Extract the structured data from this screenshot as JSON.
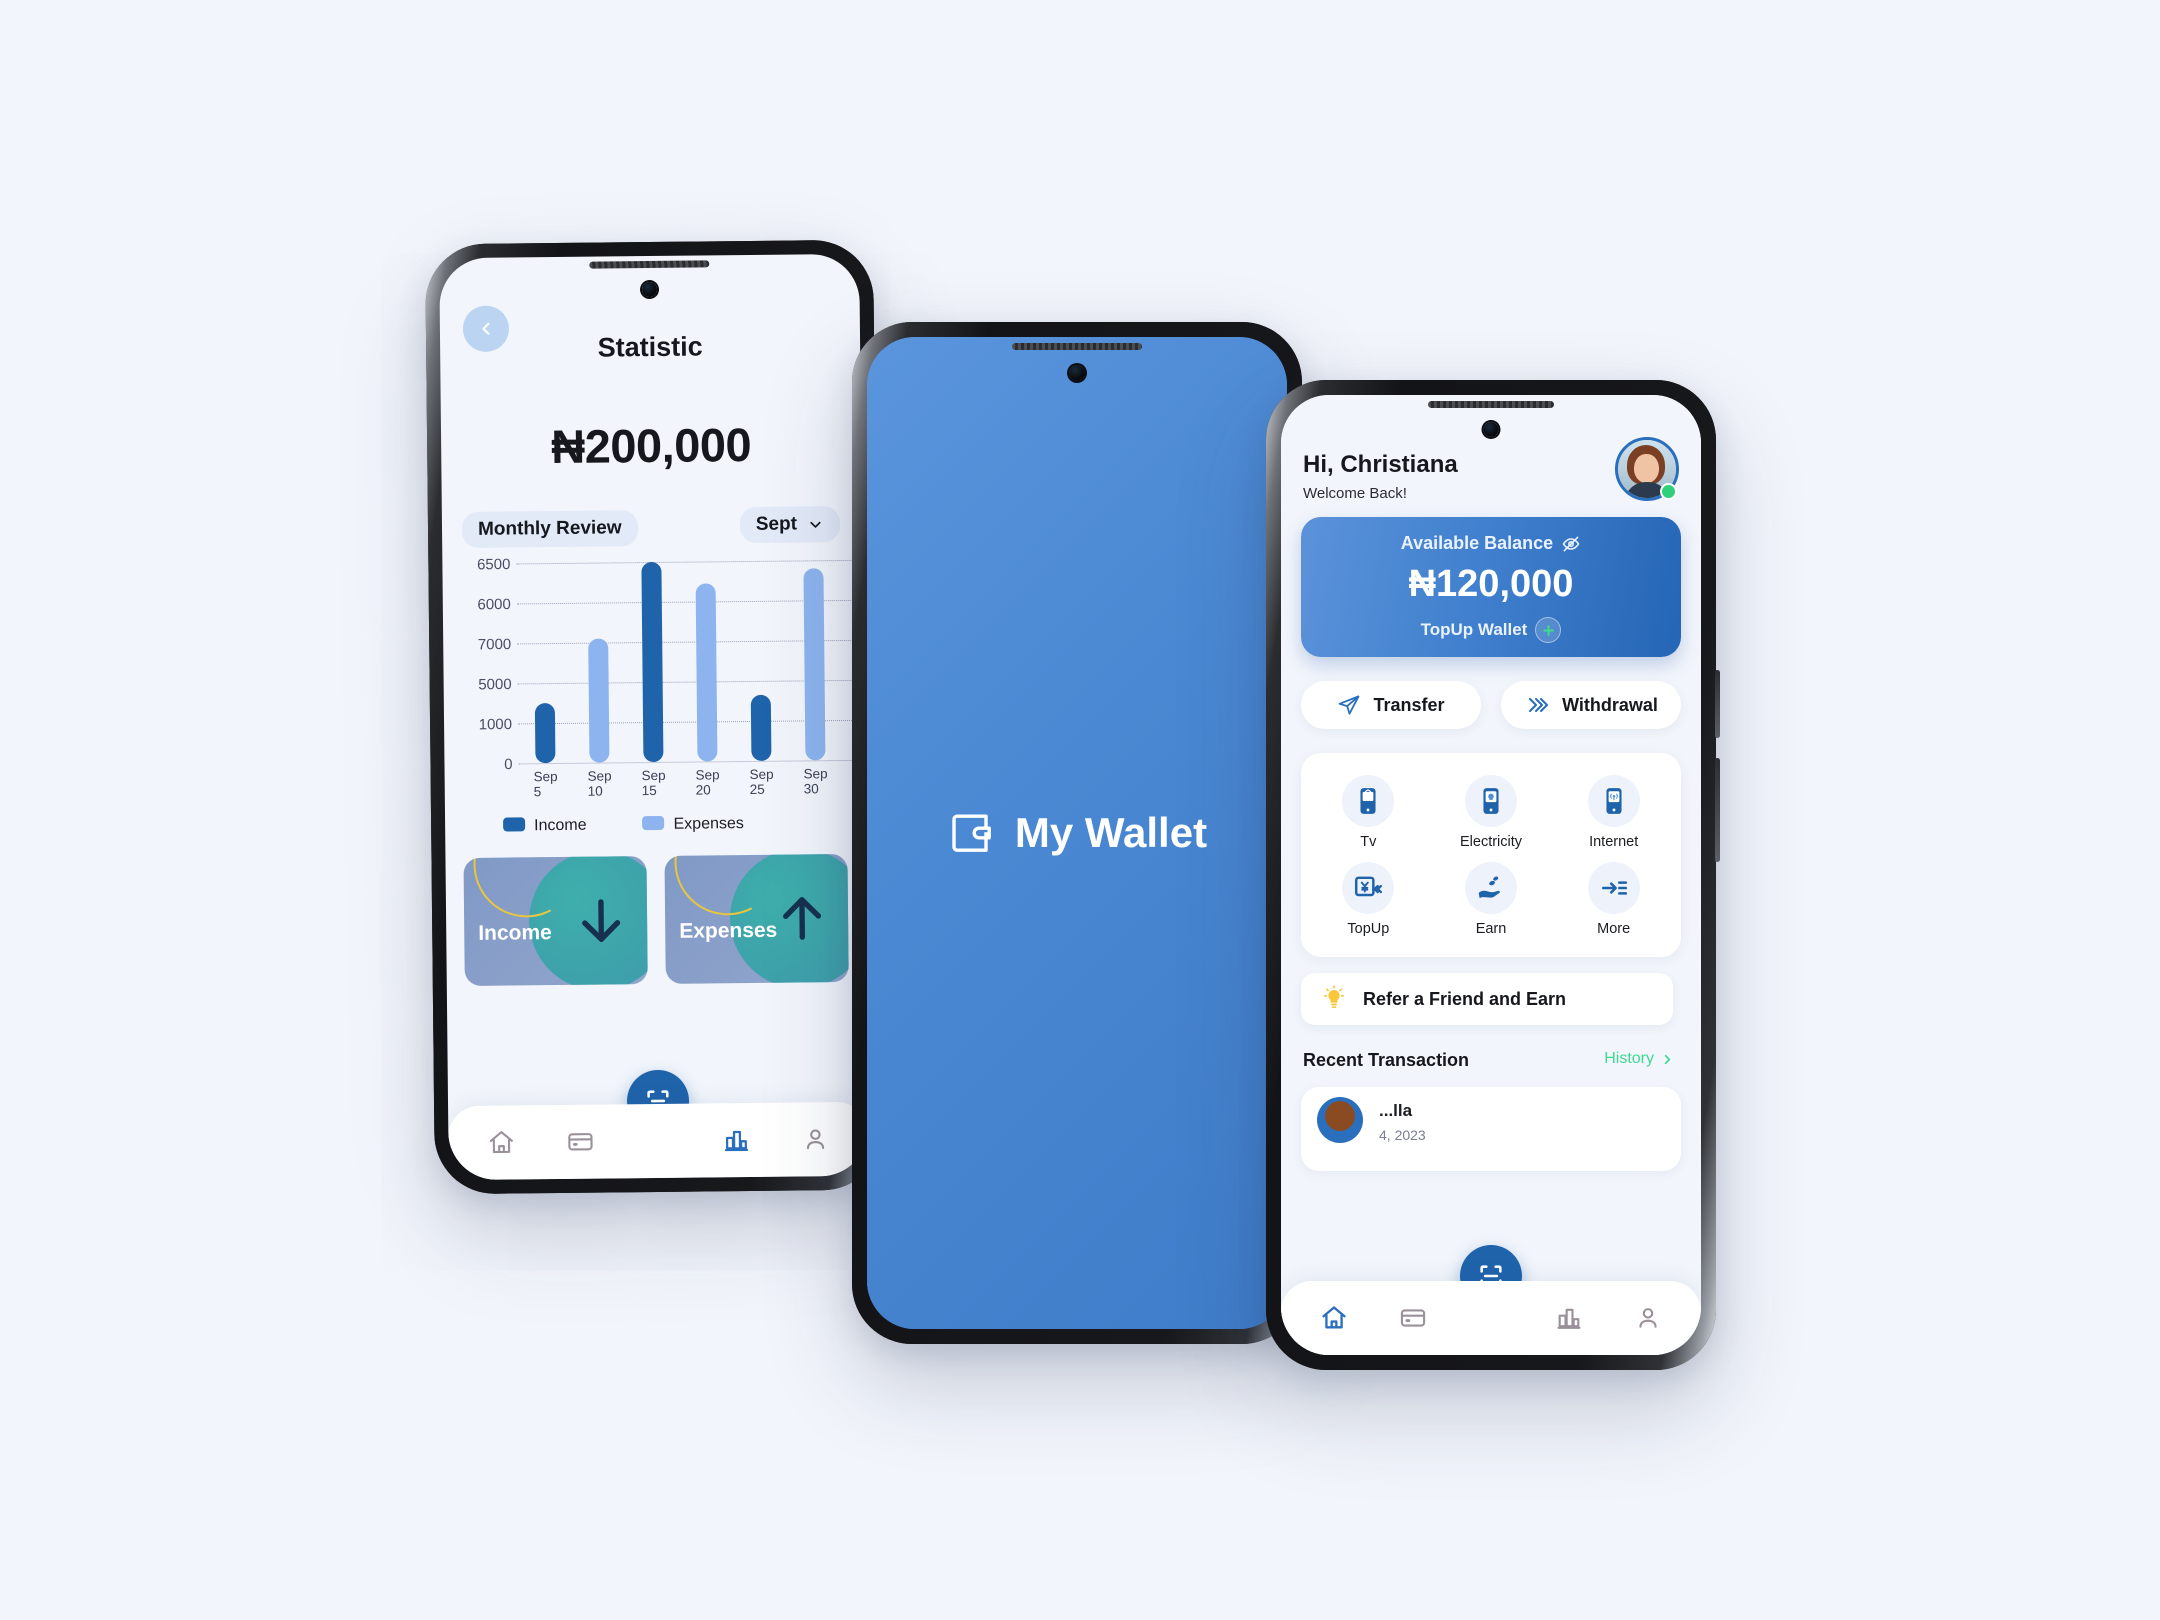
{
  "background_color": "#f2f5fb",
  "phones": {
    "left": {
      "name": "statistic-screen",
      "back_icon": "chevron-left-icon",
      "title": "Statistic",
      "amount": "₦200,000",
      "review_label": "Monthly Review",
      "month_label": "Sept",
      "month_icon": "chevron-down-icon",
      "cards": [
        {
          "label": "Income",
          "icon": "arrow-down-icon"
        },
        {
          "label": "Expenses",
          "icon": "arrow-up-icon"
        }
      ],
      "nav": [
        {
          "name": "home",
          "icon": "home-icon",
          "active": false
        },
        {
          "name": "cards",
          "icon": "credit-card-icon",
          "active": false
        },
        {
          "name": "scan",
          "icon": "scan-icon",
          "active": false
        },
        {
          "name": "statistics",
          "icon": "bar-chart-icon",
          "active": true
        },
        {
          "name": "profile",
          "icon": "person-icon",
          "active": false
        }
      ]
    },
    "middle": {
      "name": "splash-screen",
      "logo_icon": "wallet-icon",
      "app_name": "My Wallet",
      "bg_color": "#4a88d3"
    },
    "right": {
      "name": "home-screen",
      "greeting": "Hi, Christiana",
      "subgreeting": "Welcome Back!",
      "avatar_icon": "avatar",
      "status_dot_color": "#2fd07a",
      "balance": {
        "label": "Available Balance",
        "hide_icon": "eye-off-icon",
        "amount": "₦120,000",
        "topup_label": "TopUp Wallet",
        "topup_icon": "plus-icon"
      },
      "actions": [
        {
          "label": "Transfer",
          "icon": "send-icon"
        },
        {
          "label": "Withdrawal",
          "icon": "double-chevron-right-icon"
        }
      ],
      "services": [
        {
          "label": "Tv",
          "icon": "phone-tv-icon"
        },
        {
          "label": "Electricity",
          "icon": "phone-bulb-icon"
        },
        {
          "label": "Internet",
          "icon": "phone-wifi-icon"
        },
        {
          "label": "TopUp",
          "icon": "yen-topup-icon"
        },
        {
          "label": "Earn",
          "icon": "hand-coins-icon"
        },
        {
          "label": "More",
          "icon": "more-arrow-icon"
        }
      ],
      "refer": {
        "label": "Refer a Friend and Earn",
        "icon": "lightbulb-icon"
      },
      "recent": {
        "title": "Recent Transaction",
        "history_label": "History",
        "history_icon": "chevron-right-icon",
        "rows": [
          {
            "name": "...lla",
            "date": "4, 2023"
          }
        ]
      },
      "nav": [
        {
          "name": "home",
          "icon": "home-icon",
          "active": true
        },
        {
          "name": "cards",
          "icon": "credit-card-icon",
          "active": false
        },
        {
          "name": "scan",
          "icon": "scan-icon",
          "active": false
        },
        {
          "name": "statistics",
          "icon": "bar-chart-icon",
          "active": false
        },
        {
          "name": "profile",
          "icon": "person-icon",
          "active": false
        }
      ]
    }
  },
  "chart_data": {
    "type": "bar",
    "title": "Monthly Review",
    "categories": [
      "Sep 5",
      "Sep 10",
      "Sep 15",
      "Sep 20",
      "Sep 25",
      "Sep 30"
    ],
    "ytick_labels": [
      "6500",
      "6000",
      "7000",
      "5000",
      "1000",
      "0"
    ],
    "grid": true,
    "legend": [
      "Income",
      "Expenses"
    ],
    "legend_position": "bottom-left",
    "colors": {
      "Income": "#1f63ab",
      "Expenses": "#8db4ef"
    },
    "bars": [
      {
        "x": "Sep 5",
        "series": "Income",
        "height_pct": 30
      },
      {
        "x": "Sep 10",
        "series": "Expenses",
        "height_pct": 62
      },
      {
        "x": "Sep 15",
        "series": "Income",
        "height_pct": 100
      },
      {
        "x": "Sep 20",
        "series": "Expenses",
        "height_pct": 89
      },
      {
        "x": "Sep 25",
        "series": "Income",
        "height_pct": 33
      },
      {
        "x": "Sep 30",
        "series": "Expenses",
        "height_pct": 96
      }
    ]
  },
  "colors": {
    "primary_blue": "#1f63ab",
    "light_blue": "#8db4ef",
    "accent_green": "#3ed98f",
    "yellow": "#e8c63e"
  }
}
